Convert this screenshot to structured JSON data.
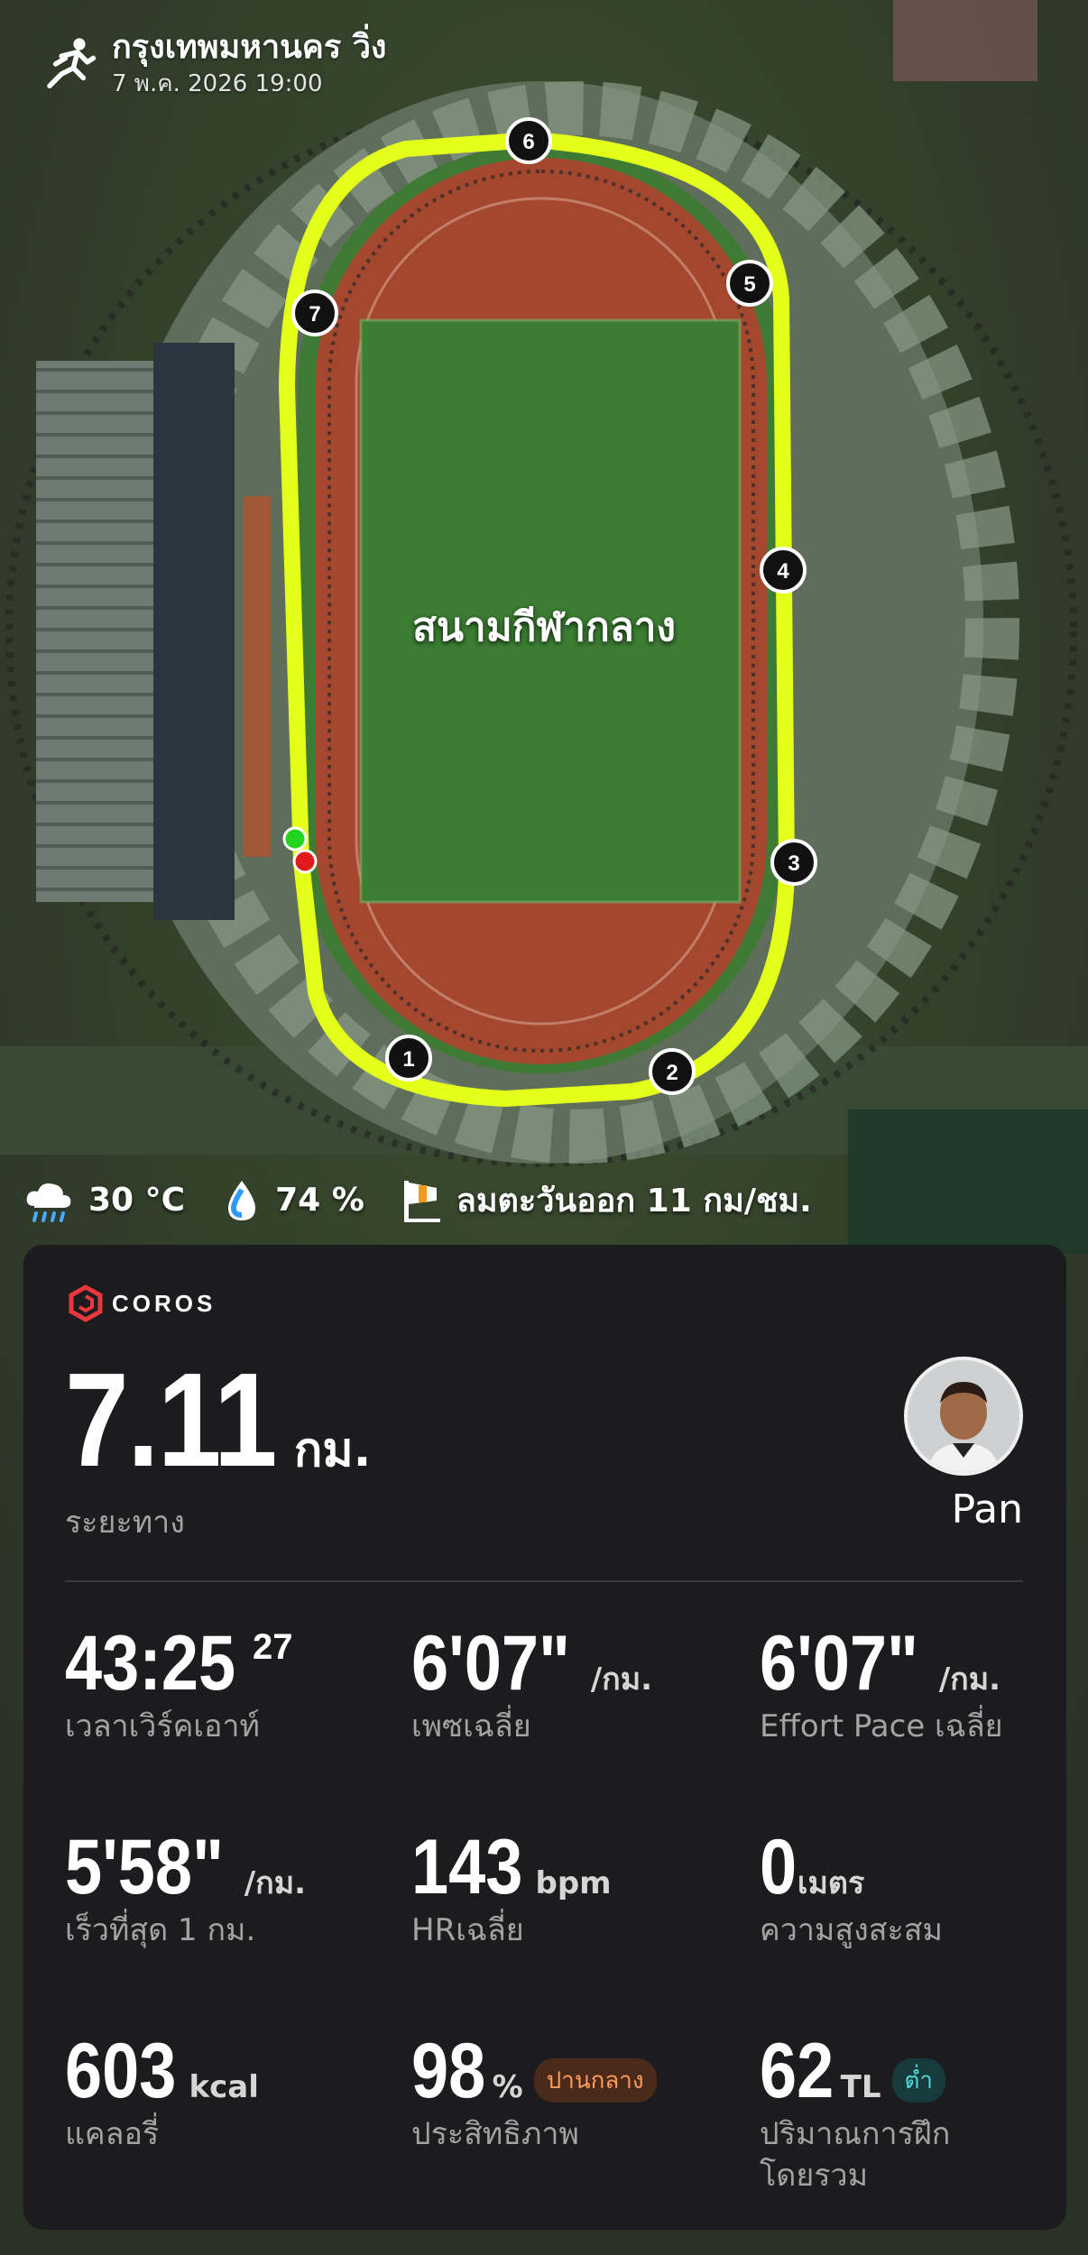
{
  "header": {
    "title": "กรุงเทพมหานคร วิ่ง",
    "datetime": "7 พ.ค. 2026 19:00",
    "icon": "running-person-icon"
  },
  "map": {
    "place_label": "สนามกีฬากลาง",
    "route_color": "#e3ff1a",
    "km_markers": [
      "1",
      "2",
      "3",
      "4",
      "5",
      "6",
      "7"
    ],
    "start_color": "#22d31f",
    "end_color": "#e01b1b"
  },
  "weather": {
    "temperature": "30 °C",
    "humidity": "74 %",
    "wind": "ลมตะวันออก 11 กม/ชม."
  },
  "card": {
    "brand": "COROS",
    "distance": {
      "value": "7.11",
      "unit": "กม.",
      "label": "ระยะทาง"
    },
    "user": {
      "name": "Pan"
    },
    "stats": [
      {
        "value": "43:25",
        "sup": "27",
        "unit": "",
        "label": "เวลาเวิร์คเอาท์"
      },
      {
        "value": "6'07\"",
        "unit": "/กม.",
        "label": "เพซเฉลี่ย"
      },
      {
        "value": "6'07\"",
        "unit": "/กม.",
        "label": "Effort Pace เฉลี่ย"
      },
      {
        "value": "5'58\"",
        "unit": "/กม.",
        "label": "เร็วที่สุด 1 กม."
      },
      {
        "value": "143",
        "unit": "bpm",
        "label": "HRเฉลี่ย"
      },
      {
        "value": "0",
        "unit": "เมตร",
        "label": "ความสูงสะสม"
      },
      {
        "value": "603",
        "unit": "kcal",
        "label": "แคลอรี่"
      },
      {
        "value": "98",
        "unit": "%",
        "badge": "ปานกลาง",
        "label": "ประสิทธิภาพ"
      },
      {
        "value": "62",
        "unit": "TL",
        "badge": "ต่ำ",
        "label": "ปริมาณการฝึก",
        "label2": "โดยรวม"
      }
    ],
    "accent_colors": {
      "orange": "#ff9a5a",
      "teal": "#4fd8d8",
      "brand_red": "#e8383d"
    }
  }
}
